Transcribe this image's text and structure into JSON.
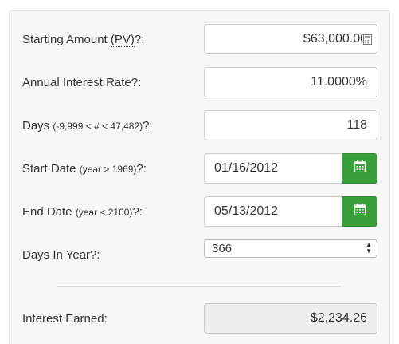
{
  "form": {
    "starting_amount": {
      "label_prefix": "Starting Amount ",
      "label_abbr": "(PV)",
      "label_suffix": "?:",
      "value": "$63,000.00"
    },
    "interest_rate": {
      "label": "Annual Interest Rate?:",
      "value": "11.0000%"
    },
    "days": {
      "label": "Days ",
      "hint": "(-9,999 < # < 47,482)",
      "label_suffix": "?:",
      "value": "118"
    },
    "start_date": {
      "label": "Start Date ",
      "hint": "(year > 1969)",
      "label_suffix": "?:",
      "value": "01/16/2012"
    },
    "end_date": {
      "label": "End Date ",
      "hint": "(year < 2100)",
      "label_suffix": "?:",
      "value": "05/13/2012"
    },
    "days_in_year": {
      "label": "Days In Year?:",
      "selected": "366"
    },
    "interest_earned": {
      "label": "Interest Earned:",
      "value": "$2,234.26"
    }
  },
  "colors": {
    "calendar_button": "#3a9e3a",
    "readonly_field": "#eceeef"
  },
  "icons": {
    "amount": "calculator-icon",
    "date": "calendar-icon"
  }
}
